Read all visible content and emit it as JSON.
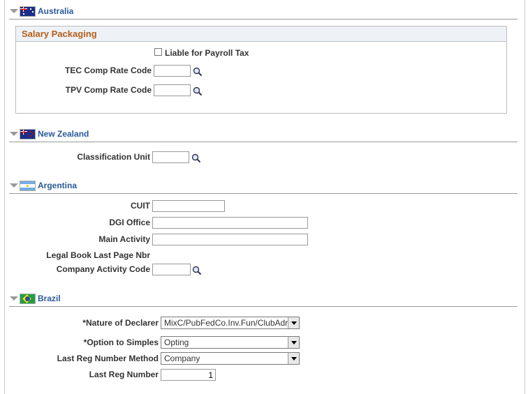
{
  "sections": {
    "australia": {
      "title": "Australia",
      "salary_packaging": {
        "title": "Salary Packaging",
        "liable_payroll_tax_label": "Liable for Payroll Tax",
        "tec_label": "TEC Comp Rate Code",
        "tpv_label": "TPV Comp Rate Code",
        "tec_value": "",
        "tpv_value": ""
      }
    },
    "new_zealand": {
      "title": "New Zealand",
      "classification_unit_label": "Classification Unit",
      "classification_unit_value": ""
    },
    "argentina": {
      "title": "Argentina",
      "cuit_label": "CUIT",
      "dgi_office_label": "DGI Office",
      "main_activity_label": "Main Activity",
      "legal_book_label": "Legal Book Last Page Nbr",
      "company_activity_label": "Company Activity Code",
      "cuit_value": "",
      "dgi_office_value": "",
      "main_activity_value": "",
      "company_activity_value": ""
    },
    "brazil": {
      "title": "Brazil",
      "nature_label": "*Nature of Declarer",
      "nature_value": "MixC/PubFedCo.Inv.Fun/ClubAdr",
      "option_label": "*Option to Simples",
      "option_value": "Opting",
      "last_reg_method_label": "Last Reg Number Method",
      "last_reg_method_value": "Company",
      "last_reg_number_label": "Last Reg Number",
      "last_reg_number_value": "1"
    }
  },
  "icons": [
    "collapse-triangle-icon",
    "flag-icon",
    "lookup-magnifier-icon",
    "dropdown-arrow-icon",
    "checkbox-icon"
  ],
  "colors": {
    "section_title": "#2a5a9a",
    "group_title": "#b45d1a",
    "group_header_bg": "#eef2f6"
  }
}
